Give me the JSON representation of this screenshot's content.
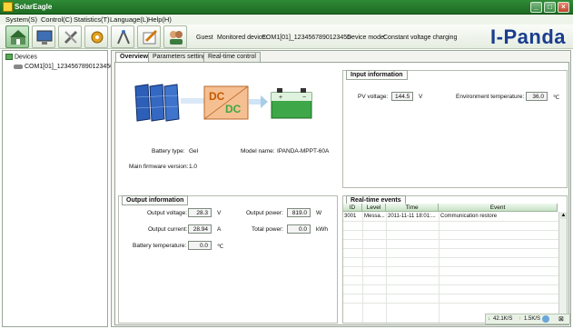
{
  "window": {
    "title": "SolarEagle"
  },
  "menu": [
    "System(S)",
    "Control(C)",
    "Statistics(T)",
    "Language(L)",
    "Help(H)"
  ],
  "toolbar": {
    "user": "Guest",
    "monitored_label": "Monitored device:",
    "monitored_value": "COM1[01]_1234567890123456",
    "mode_label": "Device mode:",
    "mode_value": "Constant voltage charging",
    "brand": "I-Panda"
  },
  "tree": {
    "root": "Devices",
    "child": "COM1[01]_1234567890123456"
  },
  "tabs": [
    "Overview",
    "Parameters setting",
    "Real-time control"
  ],
  "overview": {
    "battery_type_label": "Battery type:",
    "battery_type_value": "Gel",
    "model_label": "Model name:",
    "model_value": "IPANDA-MPPT-60A",
    "firmware_label": "Main firmware version:",
    "firmware_value": "1.0",
    "dcdc_top": "DC",
    "dcdc_bottom": "DC"
  },
  "input_info": {
    "title": "Input information",
    "pv_voltage_label": "PV voltage:",
    "pv_voltage_value": "144.5",
    "pv_voltage_unit": "V",
    "env_temp_label": "Environment temperature:",
    "env_temp_value": "36.0",
    "env_temp_unit": "℃"
  },
  "output_info": {
    "title": "Output information",
    "voltage_label": "Output voltage:",
    "voltage_value": "28.3",
    "voltage_unit": "V",
    "current_label": "Output current:",
    "current_value": "28.94",
    "current_unit": "A",
    "batt_temp_label": "Battery temperature:",
    "batt_temp_value": "0.0",
    "batt_temp_unit": "℃",
    "power_label": "Output power:",
    "power_value": "819.0",
    "power_unit": "W",
    "total_power_label": "Total power:",
    "total_power_value": "0.0",
    "total_power_unit": "kWh"
  },
  "events": {
    "title": "Real-time events",
    "columns": [
      "ID",
      "Level",
      "Time",
      "Event"
    ],
    "rows": [
      {
        "id": "3001",
        "level": "Messa...",
        "time": "2011-11-11 18:01:...",
        "event": "Communication restore"
      }
    ]
  },
  "status": {
    "down": "42.1K/S",
    "up": "1.5K/S"
  }
}
